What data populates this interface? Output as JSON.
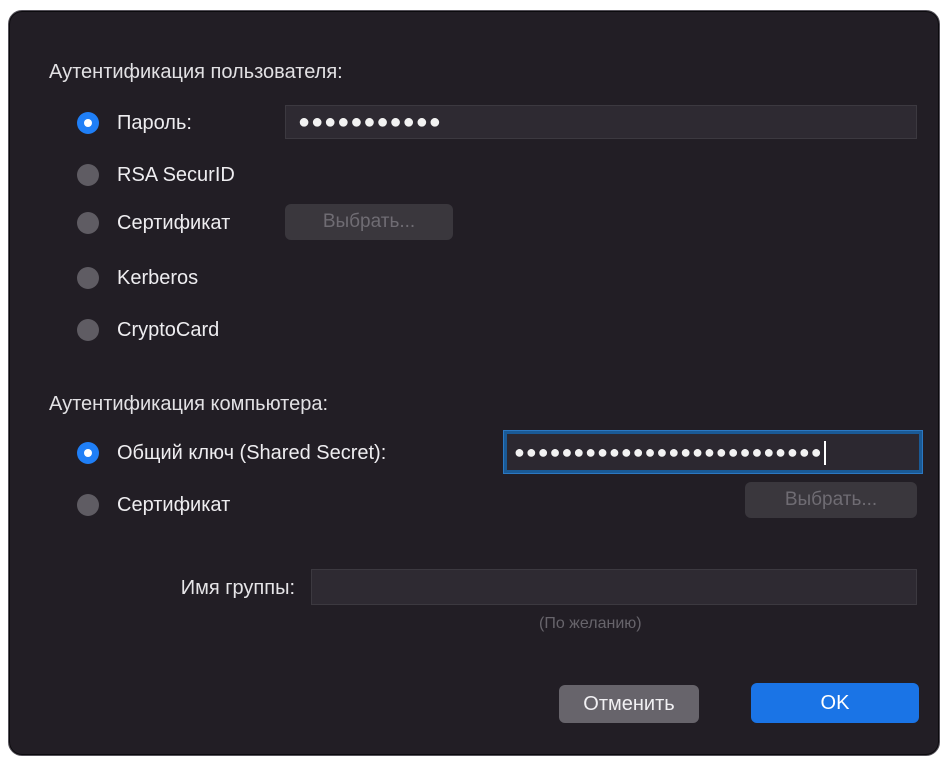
{
  "user_auth": {
    "title": "Аутентификация пользователя:",
    "password_label": "Пароль:",
    "password_value": "●●●●●●●●●●●",
    "rsa_label": "RSA SecurID",
    "certificate_label": "Сертификат",
    "choose_button": "Выбрать...",
    "kerberos_label": "Kerberos",
    "cryptocard_label": "CryptoCard",
    "selected": "password"
  },
  "machine_auth": {
    "title": "Аутентификация компьютера:",
    "shared_secret_label": "Общий ключ (Shared Secret):",
    "shared_secret_value": "●●●●●●●●●●●●●●●●●●●●●●●●●●",
    "certificate_label": "Сертификат",
    "choose_button": "Выбрать...",
    "selected": "shared_secret"
  },
  "group": {
    "label": "Имя группы:",
    "value": "",
    "hint": "(По желанию)"
  },
  "actions": {
    "cancel_label": "Отменить",
    "ok_label": "OK"
  },
  "colors": {
    "dialog_bg": "#221e25",
    "accent": "#1a74e6",
    "radio_checked": "#1f7ff7",
    "radio_unchecked": "#5f5c63"
  }
}
